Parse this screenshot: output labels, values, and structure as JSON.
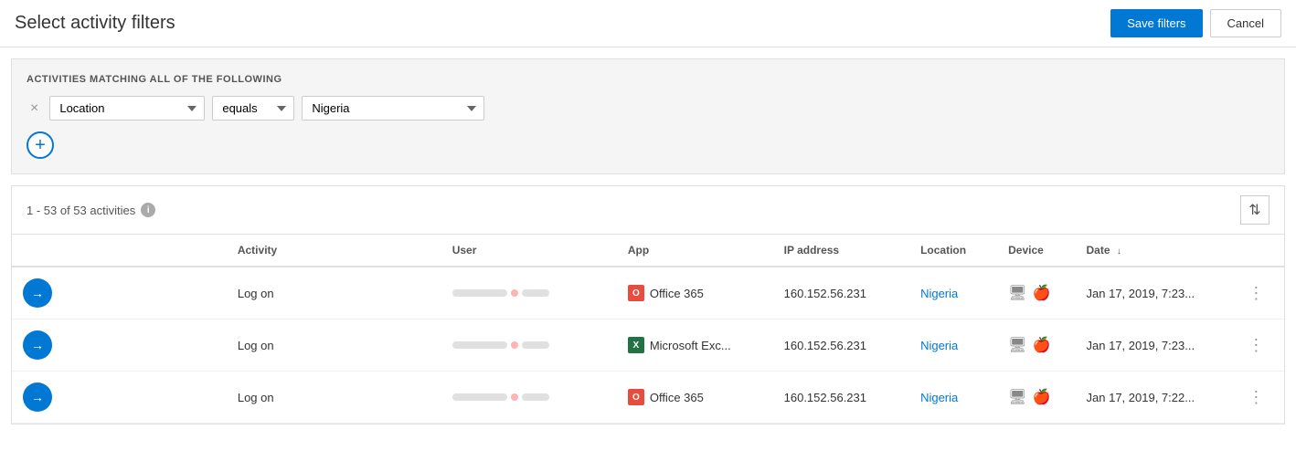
{
  "header": {
    "title": "Select activity filters",
    "save_label": "Save filters",
    "cancel_label": "Cancel"
  },
  "filter_section": {
    "label": "ACTIVITIES MATCHING ALL OF THE FOLLOWING",
    "filter": {
      "field": "Location",
      "operator": "equals",
      "value": "Nigeria"
    },
    "add_label": "+"
  },
  "results": {
    "summary": "1 - 53 of 53 activities",
    "columns_icon": "⇅"
  },
  "table": {
    "columns": [
      "Activity",
      "User",
      "App",
      "IP address",
      "Location",
      "Device",
      "Date"
    ],
    "sort_col": "Date",
    "sort_dir": "↓",
    "rows": [
      {
        "activity": "Log on",
        "app": "Office 365",
        "app_type": "o365",
        "ip": "160.152.56.231",
        "location": "Nigeria",
        "date": "Jan 17, 2019, 7:23..."
      },
      {
        "activity": "Log on",
        "app": "Microsoft Exc...",
        "app_type": "exc",
        "ip": "160.152.56.231",
        "location": "Nigeria",
        "date": "Jan 17, 2019, 7:23..."
      },
      {
        "activity": "Log on",
        "app": "Office 365",
        "app_type": "o365",
        "ip": "160.152.56.231",
        "location": "Nigeria",
        "date": "Jan 17, 2019, 7:22..."
      }
    ]
  }
}
